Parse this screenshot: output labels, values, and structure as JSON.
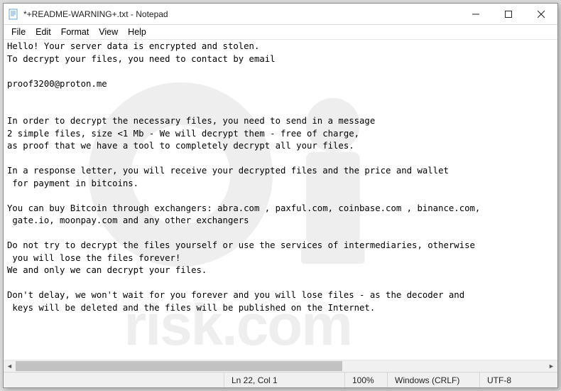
{
  "window": {
    "title": "*+README-WARNING+.txt - Notepad"
  },
  "menu": {
    "file": "File",
    "edit": "Edit",
    "format": "Format",
    "view": "View",
    "help": "Help"
  },
  "content": {
    "text": "Hello! Your server data is encrypted and stolen.\nTo decrypt your files, you need to contact by email\n\nproof3200@proton.me\n\n\nIn order to decrypt the necessary files, you need to send in a message\n2 simple files, size <1 Mb - We will decrypt them - free of charge,\nas proof that we have a tool to completely decrypt all your files.\n\nIn a response letter, you will receive your decrypted files and the price and wallet\n for payment in bitcoins.\n\nYou can buy Bitcoin through exchangers: abra.com , paxful.com, coinbase.com , binance.com,\n gate.io, moonpay.com and any other exchangers\n\nDo not try to decrypt the files yourself or use the services of intermediaries, otherwise\n you will lose the files forever!\nWe and only we can decrypt your files.\n\nDon't delay, we won't wait for you forever and you will lose files - as the decoder and\n keys will be deleted and the files will be published on the Internet."
  },
  "status": {
    "caret": "Ln 22, Col 1",
    "zoom": "100%",
    "eol": "Windows (CRLF)",
    "enc": "UTF-8"
  }
}
